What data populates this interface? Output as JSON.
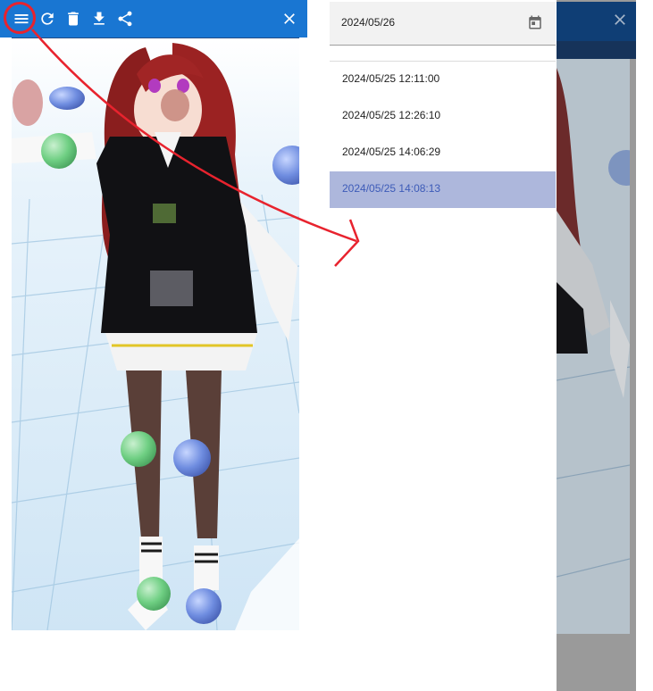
{
  "toolbar": {
    "icons": [
      "menu-icon",
      "refresh-icon",
      "delete-icon",
      "download-icon",
      "share-icon",
      "close-icon"
    ]
  },
  "drawer": {
    "date_value": "2024/05/26",
    "calendar_icon": "calendar-icon",
    "history": [
      "2024/05/25 12:11:00",
      "2024/05/25 12:26:10",
      "2024/05/25 14:06:29",
      "2024/05/25 14:08:13"
    ],
    "selected_index": 3
  },
  "colors": {
    "toolbar": "#1976d2",
    "selected_row": "#adb7dc",
    "selected_text": "#3d5bb8",
    "annotation": "#e8232e"
  }
}
